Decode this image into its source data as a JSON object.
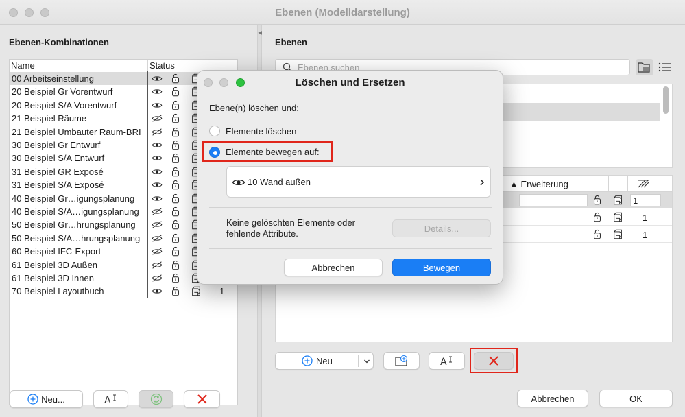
{
  "window": {
    "title": "Ebenen (Modelldarstellung)"
  },
  "left": {
    "title": "Ebenen-Kombinationen",
    "columns": {
      "name": "Name",
      "status": "Status"
    },
    "rows": [
      {
        "name": "00 Arbeitseinstellung",
        "visible": true
      },
      {
        "name": "20 Beispiel Gr Vorentwurf",
        "visible": true
      },
      {
        "name": "20 Beispiel S/A Vorentwurf",
        "visible": true
      },
      {
        "name": "21 Beispiel Räume",
        "visible": false
      },
      {
        "name": "21 Beispiel Umbauter Raum-BRI",
        "visible": false
      },
      {
        "name": "30 Beispiel Gr Entwurf",
        "visible": true
      },
      {
        "name": "30 Beispiel S/A Entwurf",
        "visible": true
      },
      {
        "name": "31 Beispiel GR Exposé",
        "visible": true
      },
      {
        "name": "31 Beispiel S/A Exposé",
        "visible": true
      },
      {
        "name": "40 Beispiel Gr…igungsplanung",
        "visible": true
      },
      {
        "name": "40 Beispiel S/A…igungsplanung",
        "visible": false
      },
      {
        "name": "50 Beispiel Gr…hrungsplanung",
        "visible": false
      },
      {
        "name": "50 Beispiel S/A…hrungsplanung",
        "visible": false
      },
      {
        "name": "60 Beispiel IFC-Export",
        "visible": false
      },
      {
        "name": "61 Beispiel 3D Außen",
        "visible": false
      },
      {
        "name": "61 Beispiel 3D Innen",
        "visible": false
      },
      {
        "name": "70 Beispiel Layoutbuch",
        "visible": true
      }
    ],
    "last_row_value": "1",
    "buttons": {
      "new_label": "Neu..."
    }
  },
  "right": {
    "title": "Ebenen",
    "search_placeholder": "Ebenen suchen",
    "columns": {
      "extension": "Erweiterung"
    },
    "layer_rows": [
      {
        "value": "1"
      },
      {
        "value": "1"
      },
      {
        "value": "1"
      }
    ],
    "buttons": {
      "new_label": "Neu",
      "cancel_label": "Abbrechen",
      "ok_label": "OK"
    }
  },
  "dialog": {
    "title": "Löschen und Ersetzen",
    "prompt": "Ebene(n) löschen und:",
    "option_delete": "Elemente löschen",
    "option_move": "Elemente bewegen auf:",
    "selected_option": "move",
    "target_layer": "10 Wand außen",
    "info_line1": "Keine gelöschten Elemente oder",
    "info_line2": "fehlende Attribute.",
    "details_label": "Details...",
    "cancel_label": "Abbrechen",
    "confirm_label": "Bewegen"
  },
  "colors": {
    "accent": "#1a7ef5",
    "danger": "#e0261b",
    "traffic_green": "#2dc240"
  }
}
